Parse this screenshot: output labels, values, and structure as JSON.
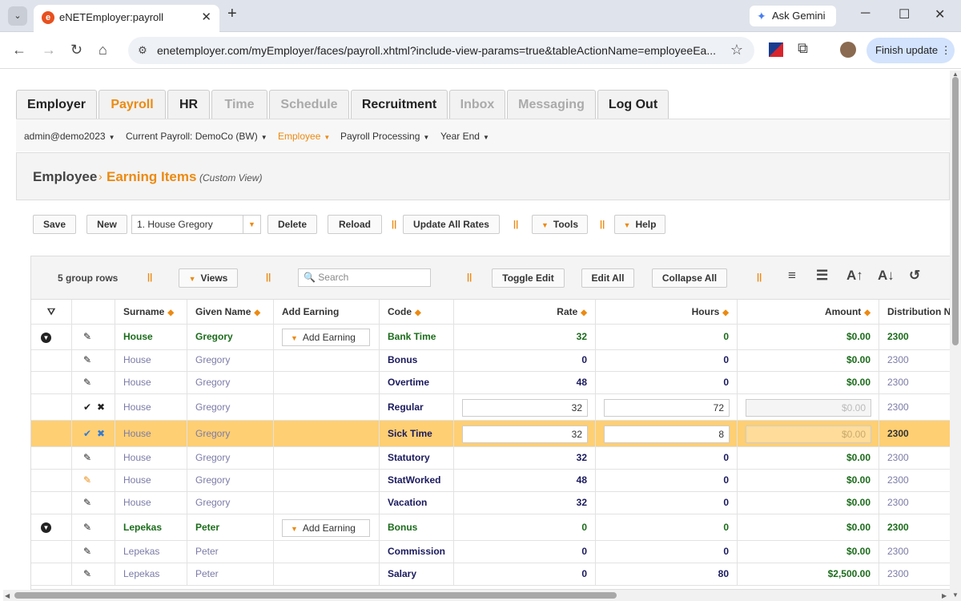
{
  "browser": {
    "tab_title": "eNETEmployer:payroll",
    "url": "enetemployer.com/myEmployer/faces/payroll.xhtml?include-view-params=true&tableActionName=employeeEa...",
    "gemini_label": "Ask Gemini",
    "finish_update_label": "Finish update"
  },
  "app_tabs": [
    {
      "label": "Employer",
      "state": "dark"
    },
    {
      "label": "Payroll",
      "state": "orange"
    },
    {
      "label": "HR",
      "state": "dark"
    },
    {
      "label": "Time",
      "state": "dim"
    },
    {
      "label": "Schedule",
      "state": "dim"
    },
    {
      "label": "Recruitment",
      "state": "dark"
    },
    {
      "label": "Inbox",
      "state": "dim"
    },
    {
      "label": "Messaging",
      "state": "dim"
    },
    {
      "label": "Log Out",
      "state": "dark"
    }
  ],
  "menus": [
    "admin@demo2023",
    "Current Payroll: DemoCo (BW)",
    "Employee",
    "Payroll Processing",
    "Year End"
  ],
  "breadcrumb": {
    "parent": "Employee",
    "current": "Earning Items",
    "view": "(Custom View)"
  },
  "actions": {
    "save": "Save",
    "new": "New",
    "selected_employee": "1. House Gregory",
    "delete": "Delete",
    "reload": "Reload",
    "update_all_rates": "Update All Rates",
    "tools": "Tools",
    "help": "Help"
  },
  "grid_toolbar": {
    "group_rows": "5 group rows",
    "views": "Views",
    "search_placeholder": "Search",
    "toggle_edit": "Toggle Edit",
    "edit_all": "Edit All",
    "collapse_all": "Collapse All"
  },
  "columns": [
    "Surname",
    "Given Name",
    "Add Earning",
    "Code",
    "Rate",
    "Hours",
    "Amount",
    "Distribution N"
  ],
  "add_earning_label": "Add Earning",
  "rows": [
    {
      "surname": "House",
      "given": "Gregory",
      "code": "Bank Time",
      "rate": "32",
      "hours": "0",
      "amount": "$0.00",
      "dist": "2300"
    },
    {
      "surname": "House",
      "given": "Gregory",
      "code": "Bonus",
      "rate": "0",
      "hours": "0",
      "amount": "$0.00",
      "dist": "2300"
    },
    {
      "surname": "House",
      "given": "Gregory",
      "code": "Overtime",
      "rate": "48",
      "hours": "0",
      "amount": "$0.00",
      "dist": "2300"
    },
    {
      "surname": "House",
      "given": "Gregory",
      "code": "Regular",
      "rate": "32",
      "hours": "72",
      "amount": "$0.00",
      "dist": "2300"
    },
    {
      "surname": "House",
      "given": "Gregory",
      "code": "Sick Time",
      "rate": "32",
      "hours": "8",
      "amount": "$0.00",
      "dist": "2300"
    },
    {
      "surname": "House",
      "given": "Gregory",
      "code": "Statutory",
      "rate": "32",
      "hours": "0",
      "amount": "$0.00",
      "dist": "2300"
    },
    {
      "surname": "House",
      "given": "Gregory",
      "code": "StatWorked",
      "rate": "48",
      "hours": "0",
      "amount": "$0.00",
      "dist": "2300"
    },
    {
      "surname": "House",
      "given": "Gregory",
      "code": "Vacation",
      "rate": "32",
      "hours": "0",
      "amount": "$0.00",
      "dist": "2300"
    },
    {
      "surname": "Lepekas",
      "given": "Peter",
      "code": "Bonus",
      "rate": "0",
      "hours": "0",
      "amount": "$0.00",
      "dist": "2300"
    },
    {
      "surname": "Lepekas",
      "given": "Peter",
      "code": "Commission",
      "rate": "0",
      "hours": "0",
      "amount": "$0.00",
      "dist": "2300"
    },
    {
      "surname": "Lepekas",
      "given": "Peter",
      "code": "Salary",
      "rate": "0",
      "hours": "80",
      "amount": "$2,500.00",
      "dist": "2300"
    }
  ]
}
